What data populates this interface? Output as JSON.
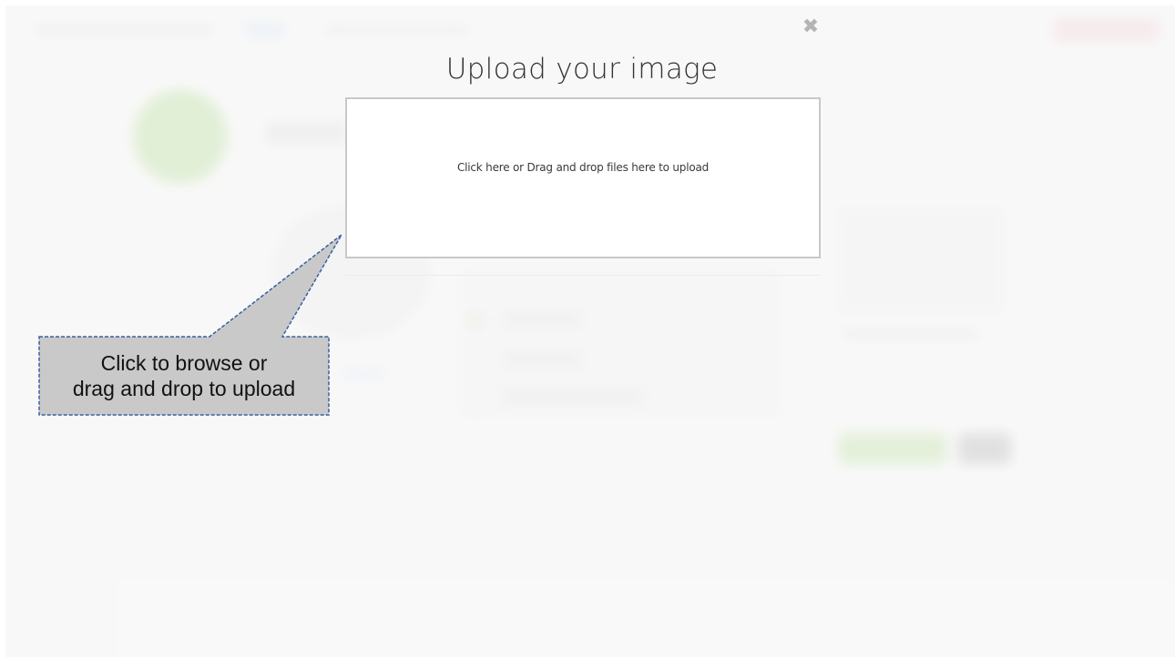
{
  "modal": {
    "title": "Upload your image",
    "close_icon": "close-icon",
    "close_glyph": "✖",
    "dropzone_message": "Click here or Drag and drop files here to upload"
  },
  "callout": {
    "line1": "Click to browse or",
    "line2": "drag and drop to upload",
    "fill_color": "#c9c9c9",
    "border_color": "#3a5fa0"
  },
  "colors": {
    "background": "#f7f7f7",
    "dropzone_border": "#c8c8c8",
    "blurred_accent_green": "#bfe0a4"
  }
}
